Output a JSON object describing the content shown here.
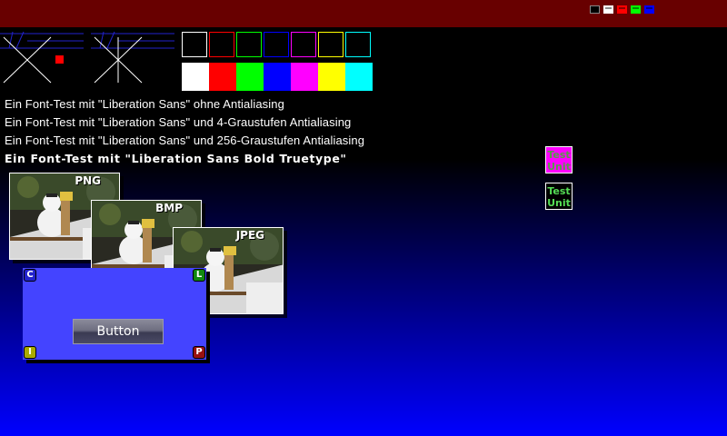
{
  "window": {
    "titlebar_color": "#680000",
    "titlebar_icons": [
      "black-square-icon",
      "white-square-icon",
      "red-square-icon",
      "green-square-icon",
      "blue-square-icon"
    ]
  },
  "colors": {
    "outline": [
      "#000000",
      "#ff0000",
      "#00ff00",
      "#0000ff",
      "#ff00ff",
      "#ffff00",
      "#00ffff"
    ],
    "filled": [
      "#ffffff",
      "#ff0000",
      "#00ff00",
      "#0000ff",
      "#ff00ff",
      "#ffff00",
      "#00ffff"
    ]
  },
  "font_tests": {
    "line1": "Ein Font-Test mit \"Liberation Sans\" ohne Antialiasing",
    "line2": "Ein Font-Test mit \"Liberation Sans\" und 4-Graustufen Antialiasing",
    "line3": "Ein Font-Test mit \"Liberation Sans\" und 256-Graustufen Antialiasing",
    "line4": "Ein Font-Test mit \"Liberation Sans Bold Truetype\""
  },
  "test_units": {
    "pink": {
      "line1": "Test",
      "line2": "Unit"
    },
    "dark": {
      "line1": "Test",
      "line2": "Unit"
    }
  },
  "images": {
    "png": "PNG",
    "bmp": "BMP",
    "jpeg": "JPEG"
  },
  "panel": {
    "corner_c": "C",
    "corner_l": "L",
    "corner_i": "I",
    "corner_p": "P",
    "button": "Button"
  }
}
